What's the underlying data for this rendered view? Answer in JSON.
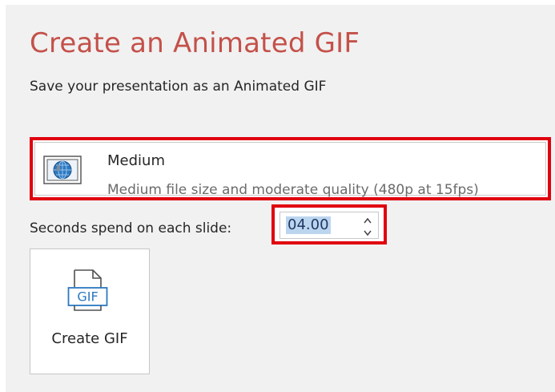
{
  "header": {
    "title": "Create an Animated GIF",
    "subtitle": "Save your presentation as an Animated GIF"
  },
  "quality": {
    "name": "Medium",
    "description": "Medium file size and moderate quality (480p at 15fps)",
    "icon": "quality-globe-icon"
  },
  "seconds": {
    "label": "Seconds spend on each slide:",
    "value": "04.00"
  },
  "create_button": {
    "label": "Create GIF",
    "icon_text": "GIF",
    "icon": "gif-file-icon"
  },
  "colors": {
    "title": "#c4514a",
    "highlight_border": "#e0000f",
    "selection": "#bcd5ef",
    "icon_blue": "#2b79c2"
  }
}
